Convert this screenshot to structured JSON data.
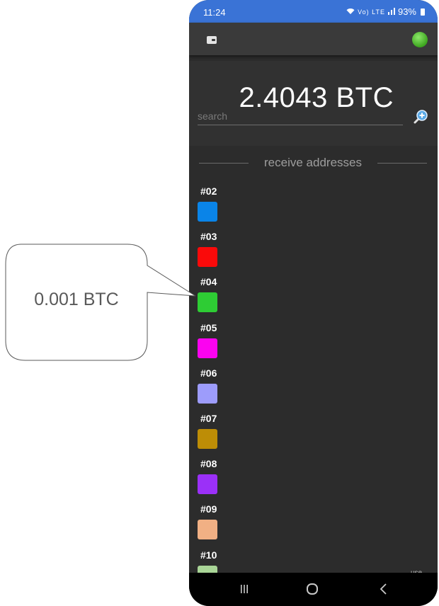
{
  "callout": {
    "text": "0.001 BTC"
  },
  "status_bar": {
    "time": "11:24",
    "network": "Vo) LTE",
    "battery": "93%"
  },
  "app_bar": {
    "left_icon": "wallet-icon",
    "status_indicator_color": "#4caf2a"
  },
  "wallet": {
    "balance": "2.4043 BTC",
    "search_placeholder": "search"
  },
  "section": {
    "title": "receive addresses"
  },
  "addresses": [
    {
      "label": "#02",
      "color": "#0a84e8"
    },
    {
      "label": "#03",
      "color": "#fa0a0a"
    },
    {
      "label": "#04",
      "color": "#2ecc34"
    },
    {
      "label": "#05",
      "color": "#fb03f0"
    },
    {
      "label": "#06",
      "color": "#9d9cfb"
    },
    {
      "label": "#07",
      "color": "#bd8d06"
    },
    {
      "label": "#08",
      "color": "#9b30f8"
    },
    {
      "label": "#09",
      "color": "#f1b084"
    },
    {
      "label": "#10",
      "color": "#a9d597"
    }
  ],
  "partial_text": "use label",
  "nav": {
    "recents": "recents-icon",
    "home": "home-icon",
    "back": "back-icon"
  }
}
